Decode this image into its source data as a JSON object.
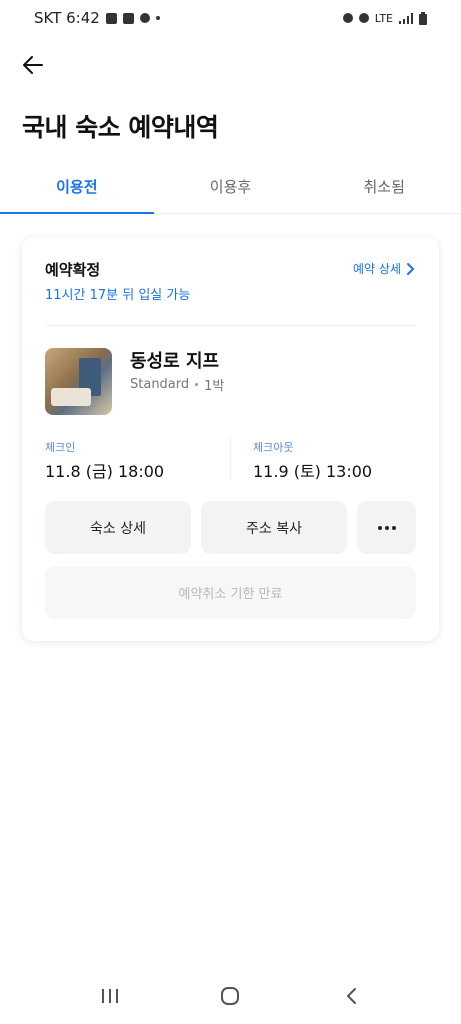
{
  "status_bar": {
    "carrier_time": "SKT 6:42",
    "network": "LTE"
  },
  "header": {
    "title": "국내 숙소 예약내역"
  },
  "tabs": [
    {
      "label": "이용전",
      "active": true
    },
    {
      "label": "이용후",
      "active": false
    },
    {
      "label": "취소됨",
      "active": false
    }
  ],
  "booking": {
    "status": "예약확정",
    "checkin_note": "11시간 17분 뒤 입실 가능",
    "detail_link": "예약 상세",
    "hotel_name": "동성로 지프",
    "room_type": "Standard",
    "nights": "1박",
    "checkin_label": "체크인",
    "checkin_value": "11.8 (금) 18:00",
    "checkout_label": "체크아웃",
    "checkout_value": "11.9 (토) 13:00",
    "buttons": {
      "hotel_detail": "숙소 상세",
      "copy_address": "주소 복사"
    },
    "cancel_deadline": "예약취소 기한 만료"
  },
  "colors": {
    "accent": "#1a73e8",
    "button_bg": "#f2f3f5",
    "disabled_text": "#b8b8b8"
  }
}
